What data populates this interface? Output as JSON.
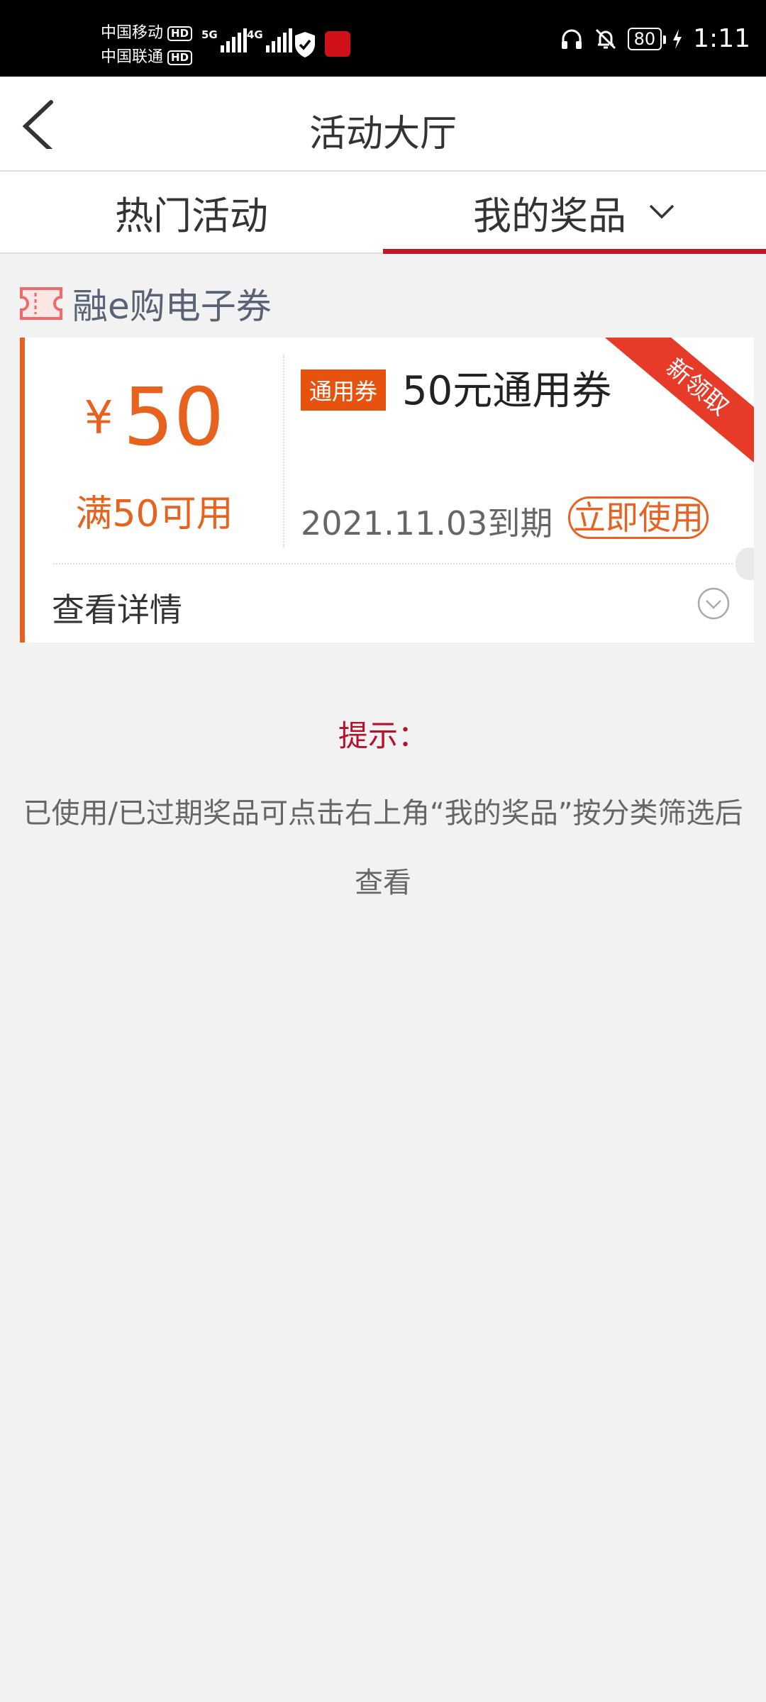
{
  "status_bar": {
    "carrier1": "中国移动",
    "carrier2": "中国联通",
    "hd_label": "HD",
    "net1": "5G",
    "net2": "4G",
    "battery": "80",
    "time": "1:11"
  },
  "header": {
    "title": "活动大厅"
  },
  "tabs": [
    {
      "label": "热门活动",
      "active": false
    },
    {
      "label": "我的奖品",
      "active": true
    }
  ],
  "section": {
    "title": "融e购电子券"
  },
  "coupon": {
    "currency": "¥",
    "amount": "50",
    "condition": "满50可用",
    "type_badge": "通用券",
    "name": "50元通用券",
    "ribbon": "新领取",
    "expiry": "2021.11.03到期",
    "use_button": "立即使用",
    "details_label": "查看详情"
  },
  "tip": {
    "title": "提示：",
    "text": "已使用/已过期奖品可点击右上角“我的奖品”按分类筛选后查看"
  },
  "colors": {
    "accent_orange": "#e8621f",
    "tab_underline": "#c0172b",
    "tip_red": "#b3122a",
    "ribbon_red": "#e83a28"
  }
}
